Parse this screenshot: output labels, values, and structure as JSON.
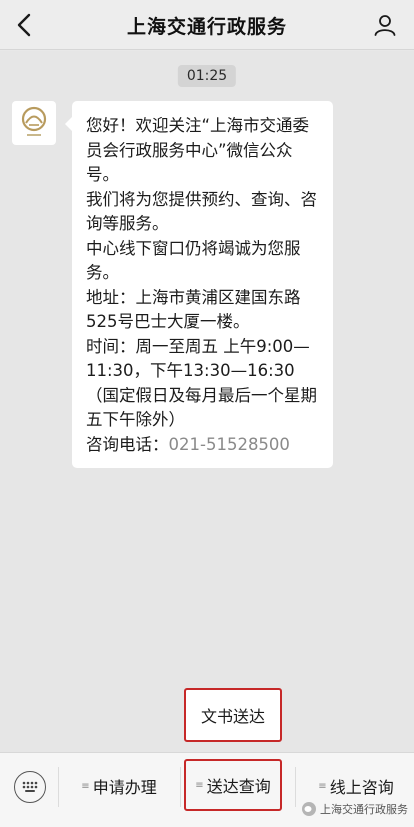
{
  "header": {
    "title": "上海交通行政服务"
  },
  "chat": {
    "timestamp": "01:25",
    "message_lines": [
      "您好！欢迎关注“上海市交通委员会行政服务中心”微信公众号。",
      "我们将为您提供预约、查询、咨询等服务。",
      "中心线下窗口仍将竭诚为您服务。",
      "地址：上海市黄浦区建国东路525号巴士大厦一楼。",
      "时间：周一至周五 上午9:00—11:30，下午13:30—16:30（国定假日及每月最后一个星期五下午除外）"
    ],
    "phone_label": "咨询电话：",
    "phone_number": "021-51528500"
  },
  "popup": {
    "label": "文书送达"
  },
  "menu": {
    "items": [
      {
        "label": "申请办理"
      },
      {
        "label": "送达查询"
      },
      {
        "label": "线上咨询"
      }
    ]
  },
  "watermark": {
    "text": "上海交通行政服务"
  },
  "colors": {
    "highlight_border": "#c62828",
    "chat_bg": "#e6e6e6",
    "bubble_bg": "#ffffff"
  }
}
